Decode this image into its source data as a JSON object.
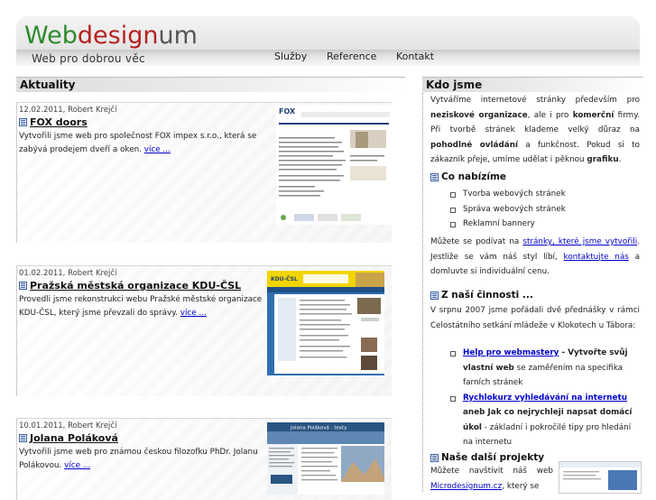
{
  "logo": {
    "part1": "Web",
    "part2": "design",
    "part3": "um"
  },
  "tagline": "Web pro dobrou věc",
  "nav": [
    "Služby",
    "Reference",
    "Kontakt"
  ],
  "left": {
    "title": "Aktuality",
    "news": [
      {
        "date": "12.02.2011, Robert Krejčí",
        "title": "FOX doors",
        "text": "Vytvořili jsme web pro společnost FOX impex s.r.o., která se zabývá prodejem dveří a oken.",
        "more": "více ..."
      },
      {
        "date": "01.02.2011, Robert Krejčí",
        "title": "Pražská městská organizace KDU-ČSL",
        "text": "Provedli jsme rekonstrukci webu Pražské městské organizace KDU-ČSL, který jsme převzali do správy.",
        "more": "více ..."
      },
      {
        "date": "10.01.2011, Robert Krejčí",
        "title": "Jolana Poláková",
        "text": "Vytvořili jsme web pro známou českou filozofku PhDr. Jolanu Polákovou.",
        "more": "více ..."
      }
    ],
    "thumbs": {
      "fox_brand": "FOX",
      "kdu_brand": "KDU-ČSL",
      "jolana_title": "Jolana Poláková - texty"
    }
  },
  "right": {
    "title": "Kdo jsme",
    "intro": {
      "a": "Vytváříme internetové stránky především pro ",
      "b": "neziskové organizace",
      "c": ", ale i pro ",
      "d": "komerční",
      "e": " firmy. Při tvorbě stránek klademe velký důraz na ",
      "f": "pohodlné ovládání",
      "g": " a funkčnost. Pokud si to zákazník přeje, umíme udělat i pěknou ",
      "h": "grafiku",
      "i": "."
    },
    "offer_heading": "Co nabízíme",
    "offer_items": [
      "Tvorba webových stránek",
      "Správa webových stránek",
      "Reklamní bannery"
    ],
    "look": {
      "a": "Můžete se podívat na ",
      "link1": "stránky, které jsme vytvořili",
      "b": ". Jestliže se vám náš styl líbí, ",
      "link2": "kontaktujte nás",
      "c": " a domluvte si individuální cenu."
    },
    "activity_heading": "Z naší činnosti ...",
    "activity_text": "V srpnu 2007 jsme pořádali dvě přednášky v rámci Celostátního setkání mládeže v Klokotech u Tábora:",
    "activity_items": [
      {
        "link": "Help pro webmastery",
        "bold": " - Vytvořte svůj vlastní web",
        "rest": " se zaměřením na specifika farních stránek"
      },
      {
        "link": "Rychlokurz vyhledávání na internetu",
        "bold": " aneb Jak co nejrychleji napsat domácí úkol",
        "rest": " - základní i pokročilé tipy pro hledání na internetu"
      }
    ],
    "projects_heading": "Naše další projekty",
    "projects_text": {
      "a": "Můžete navštívit náš web ",
      "link": "Microdesignum.cz",
      "b": ", který se"
    }
  },
  "colors": {
    "web": "#2e8b2e",
    "design": "#b52121",
    "um": "#555555",
    "link": "#0000cc"
  }
}
